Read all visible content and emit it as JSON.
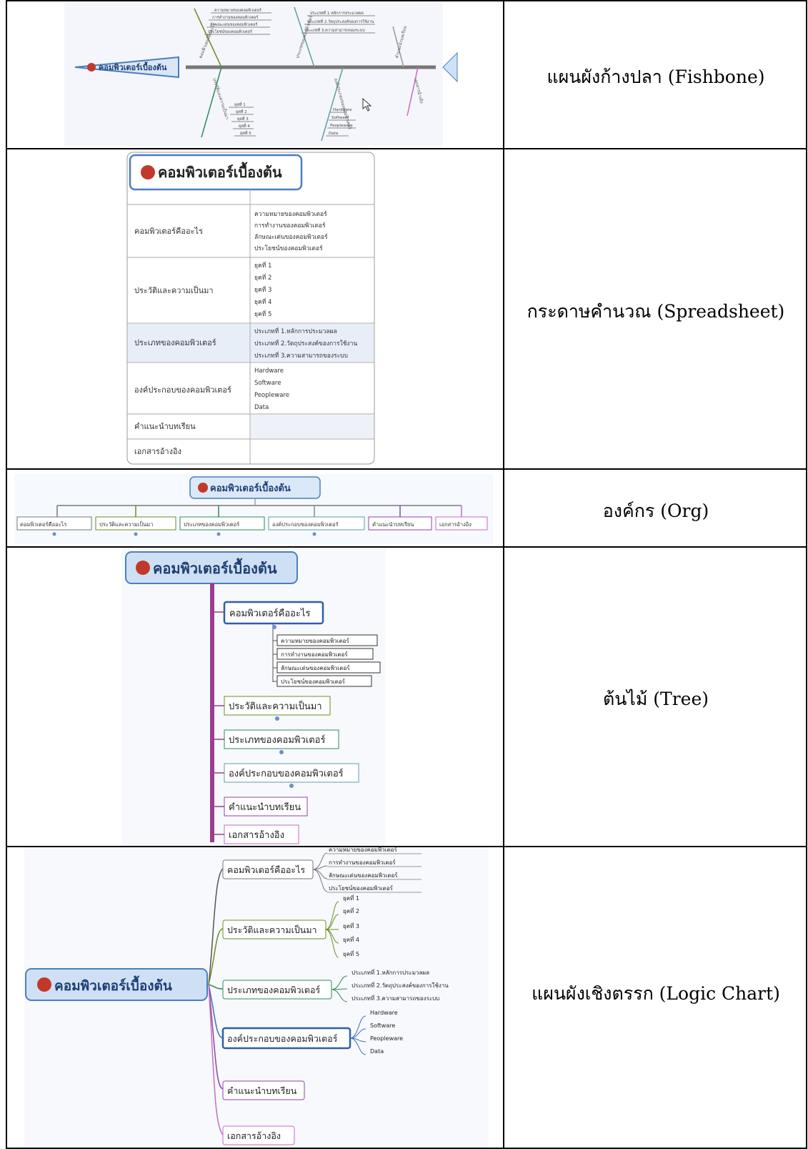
{
  "root": "คอมพิวเตอร์เบื้องต้น",
  "branches": [
    "คอมพิวเตอร์คืออะไร",
    "ประวัติและความเป็นมา",
    "ประเภทของคอมพิวเตอร์",
    "องค์ประกอบของคอมพิวเตอร์",
    "คำแนะนำบทเรียน",
    "เอกสารอ้างอิง"
  ],
  "b1_items": [
    "ความหมายของคอมพิวเตอร์",
    "การทำงานของคอมพิวเตอร์",
    "ลักษณะเด่นของคอมพิวเตอร์",
    "ประโยชน์ของคอมพิวเตอร์"
  ],
  "b2_items": [
    "ยุคที่ 1",
    "ยุคที่ 2",
    "ยุคที่ 3",
    "ยุคที่ 4",
    "ยุคที่ 5"
  ],
  "b3_items": [
    "ประเภทที่ 1.หลักการประมวลผล",
    "ประเภทที่ 2.วัตถุประสงค์ของการใช้งาน",
    "ประเภทที่ 3.ความสามารถของระบบ"
  ],
  "b4_items": [
    "Hardware",
    "Software",
    "Peopleware",
    "Data"
  ],
  "labels": {
    "fishbone": "แผนผังก้างปลา (Fishbone)",
    "spreadsheet": "กระดาษคำนวณ (Spreadsheet)",
    "org": "องค์กร (Org)",
    "tree": "ต้นไม้ (Tree)",
    "logic": "แผนผังเชิงตรรก (Logic Chart)"
  },
  "colors": {
    "rootBlue": "#4a7fc1",
    "branchGray": "#666666",
    "line1": "#6b8e23",
    "line2": "#2e8b57",
    "line3": "#5f9ea0",
    "line4": "#8e44ad",
    "icon": "#c0392b"
  }
}
